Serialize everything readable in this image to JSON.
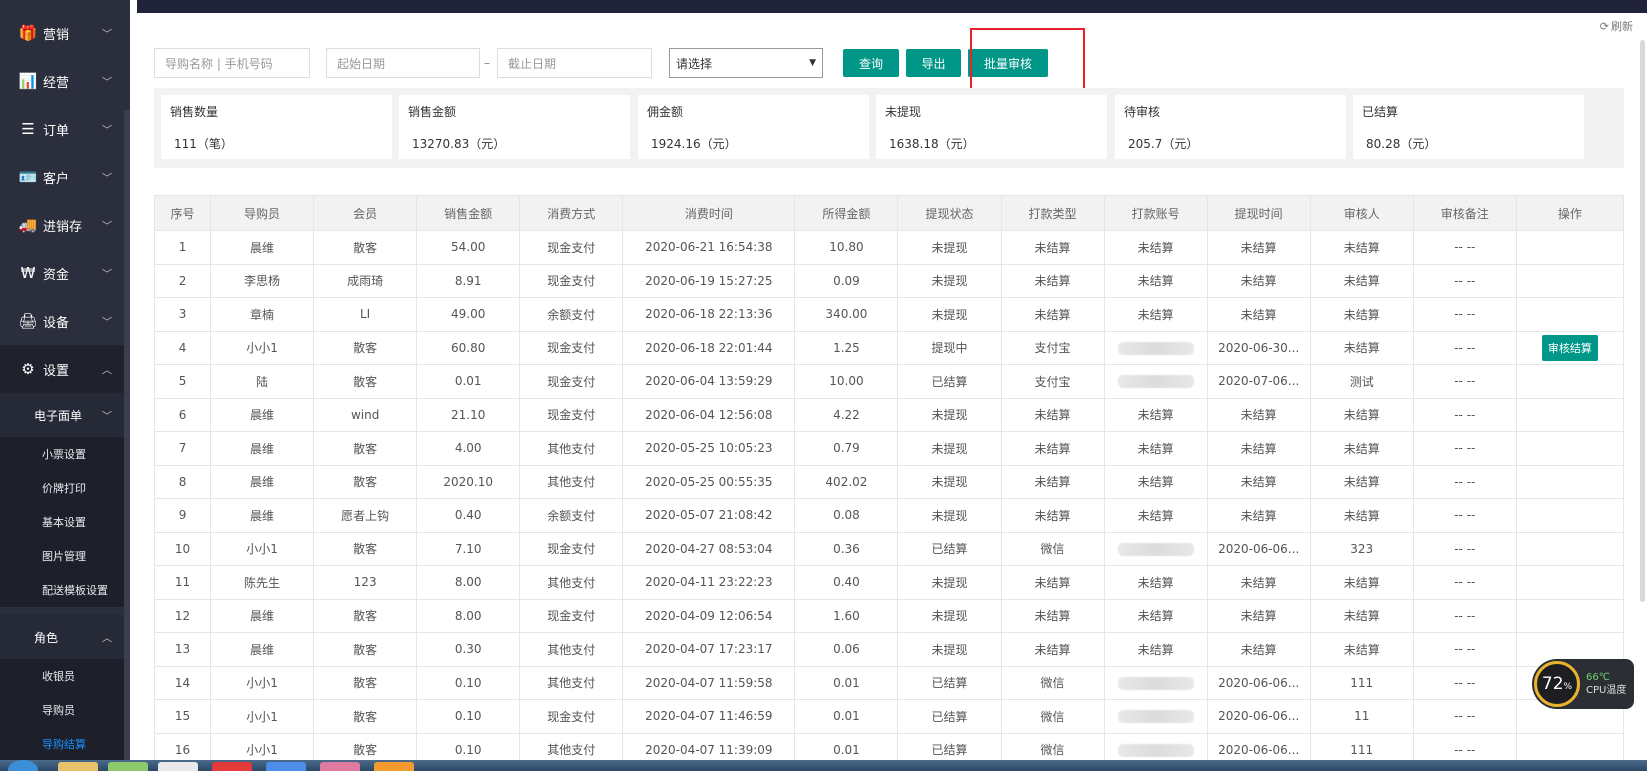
{
  "sidebar": {
    "items": [
      {
        "label": "营销",
        "icon": "gift-icon",
        "glyph": "🎁"
      },
      {
        "label": "经营",
        "icon": "bar-chart-icon",
        "glyph": "📊"
      },
      {
        "label": "订单",
        "icon": "list-icon",
        "glyph": "☰"
      },
      {
        "label": "客户",
        "icon": "id-card-icon",
        "glyph": "🪪"
      },
      {
        "label": "进销存",
        "icon": "truck-icon",
        "glyph": "🚚"
      },
      {
        "label": "资金",
        "icon": "won-icon",
        "glyph": "₩"
      },
      {
        "label": "设备",
        "icon": "printer-icon",
        "glyph": "🖨"
      },
      {
        "label": "设置",
        "icon": "gear-icon",
        "glyph": "⚙"
      }
    ],
    "groups": [
      {
        "label": "电子面单",
        "children": [
          "小票设置",
          "价牌打印",
          "基本设置",
          "图片管理",
          "配送模板设置"
        ]
      },
      {
        "label": "角色",
        "children": [
          "收银员",
          "导购员",
          "导购结算"
        ]
      }
    ]
  },
  "toolbar": {
    "refresh_label": "刷新",
    "name_placeholder": "导购名称 | 手机号码",
    "start_placeholder": "起始日期",
    "end_placeholder": "截止日期",
    "range_separator": "–",
    "select_value": "请选择",
    "query_label": "查询",
    "export_label": "导出",
    "batch_review_label": "批量审核"
  },
  "stats": [
    {
      "title": "销售数量",
      "value": "111（笔）"
    },
    {
      "title": "销售金额",
      "value": "13270.83（元）"
    },
    {
      "title": "佣金额",
      "value": "1924.16（元）"
    },
    {
      "title": "未提现",
      "value": "1638.18（元）"
    },
    {
      "title": "待审核",
      "value": "205.7（元）"
    },
    {
      "title": "已结算",
      "value": "80.28（元）"
    }
  ],
  "table": {
    "columns": [
      "序号",
      "导购员",
      "会员",
      "销售金额",
      "消费方式",
      "消费时间",
      "所得金额",
      "提现状态",
      "打款类型",
      "打款账号",
      "提现时间",
      "审核人",
      "审核备注",
      "操作"
    ],
    "rows": [
      [
        "1",
        "晨维",
        "散客",
        "54.00",
        "现金支付",
        "2020-06-21 16:54:38",
        "10.80",
        "未提现",
        "未结算",
        "未结算",
        "未结算",
        "未结算",
        "-- --",
        ""
      ],
      [
        "2",
        "李思杨",
        "成雨琦",
        "8.91",
        "现金支付",
        "2020-06-19 15:27:25",
        "0.09",
        "未提现",
        "未结算",
        "未结算",
        "未结算",
        "未结算",
        "-- --",
        ""
      ],
      [
        "3",
        "章楠",
        "LI",
        "49.00",
        "余额支付",
        "2020-06-18 22:13:36",
        "340.00",
        "未提现",
        "未结算",
        "未结算",
        "未结算",
        "未结算",
        "-- --",
        ""
      ],
      [
        "4",
        "小小1",
        "散客",
        "60.80",
        "现金支付",
        "2020-06-18 22:01:44",
        "1.25",
        "提现中",
        "支付宝",
        "[blur]",
        "2020-06-30...",
        "未结算",
        "-- --",
        "审核结算"
      ],
      [
        "5",
        "陆",
        "散客",
        "0.01",
        "现金支付",
        "2020-06-04 13:59:29",
        "10.00",
        "已结算",
        "支付宝",
        "[blur]",
        "2020-07-06...",
        "测试",
        "-- --",
        ""
      ],
      [
        "6",
        "晨维",
        "wind",
        "21.10",
        "现金支付",
        "2020-06-04 12:56:08",
        "4.22",
        "未提现",
        "未结算",
        "未结算",
        "未结算",
        "未结算",
        "-- --",
        ""
      ],
      [
        "7",
        "晨维",
        "散客",
        "4.00",
        "其他支付",
        "2020-05-25 10:05:23",
        "0.79",
        "未提现",
        "未结算",
        "未结算",
        "未结算",
        "未结算",
        "-- --",
        ""
      ],
      [
        "8",
        "晨维",
        "散客",
        "2020.10",
        "其他支付",
        "2020-05-25 00:55:35",
        "402.02",
        "未提现",
        "未结算",
        "未结算",
        "未结算",
        "未结算",
        "-- --",
        ""
      ],
      [
        "9",
        "晨维",
        "愿者上钩",
        "0.40",
        "余额支付",
        "2020-05-07 21:08:42",
        "0.08",
        "未提现",
        "未结算",
        "未结算",
        "未结算",
        "未结算",
        "-- --",
        ""
      ],
      [
        "10",
        "小小1",
        "散客",
        "7.10",
        "现金支付",
        "2020-04-27 08:53:04",
        "0.36",
        "已结算",
        "微信",
        "[blur]",
        "2020-06-06...",
        "323",
        "-- --",
        ""
      ],
      [
        "11",
        "陈先生",
        "123",
        "8.00",
        "其他支付",
        "2020-04-11 23:22:23",
        "0.40",
        "未提现",
        "未结算",
        "未结算",
        "未结算",
        "未结算",
        "-- --",
        ""
      ],
      [
        "12",
        "晨维",
        "散客",
        "8.00",
        "现金支付",
        "2020-04-09 12:06:54",
        "1.60",
        "未提现",
        "未结算",
        "未结算",
        "未结算",
        "未结算",
        "-- --",
        ""
      ],
      [
        "13",
        "晨维",
        "散客",
        "0.30",
        "其他支付",
        "2020-04-07 17:23:17",
        "0.06",
        "未提现",
        "未结算",
        "未结算",
        "未结算",
        "未结算",
        "-- --",
        ""
      ],
      [
        "14",
        "小小1",
        "散客",
        "0.10",
        "其他支付",
        "2020-04-07 11:59:58",
        "0.01",
        "已结算",
        "微信",
        "[blur]",
        "2020-06-06...",
        "111",
        "-- --",
        ""
      ],
      [
        "15",
        "小小1",
        "散客",
        "0.10",
        "现金支付",
        "2020-04-07 11:46:59",
        "0.01",
        "已结算",
        "微信",
        "[blur]",
        "2020-06-06...",
        "11",
        "-- --",
        ""
      ],
      [
        "16",
        "小小1",
        "散客",
        "0.10",
        "其他支付",
        "2020-04-07 11:39:09",
        "0.01",
        "已结算",
        "微信",
        "[blur]",
        "2020-06-06...",
        "111",
        "-- --",
        ""
      ]
    ]
  },
  "cpu_widget": {
    "usage": "72",
    "usage_unit": "%",
    "temperature": "66℃",
    "label": "CPU温度"
  },
  "colors": {
    "primary": "#009688",
    "sidebar_bg": "#2b2e3c",
    "highlight": "#e8212b",
    "active_link": "#1890ff"
  }
}
